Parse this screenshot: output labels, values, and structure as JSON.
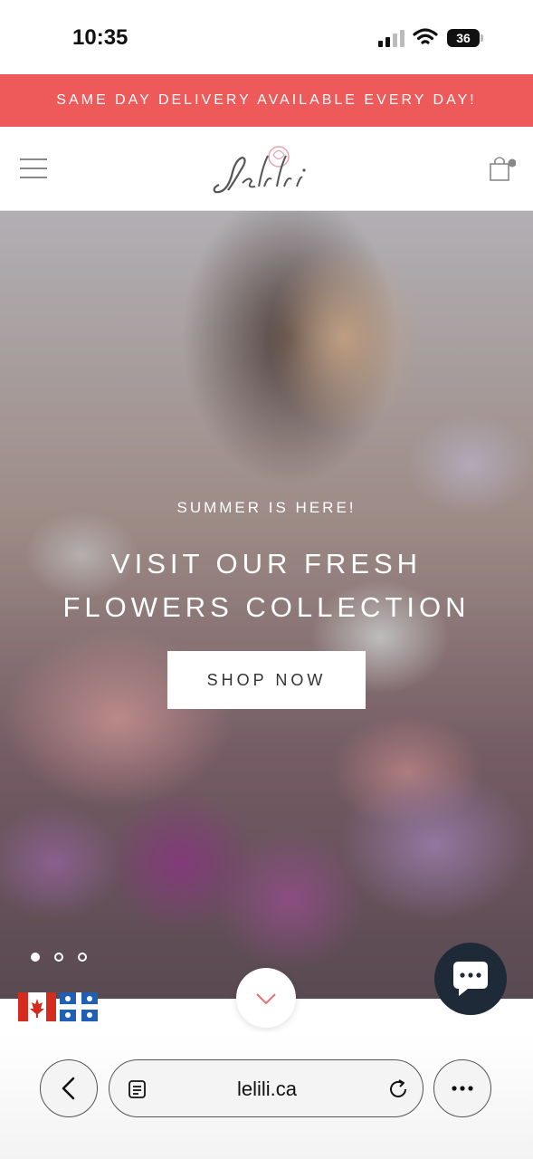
{
  "status_bar": {
    "time": "10:35",
    "battery": "36",
    "icons": [
      "signal-icon",
      "wifi-icon",
      "battery-icon"
    ]
  },
  "promo": {
    "text": "SAME DAY DELIVERY AVAILABLE EVERY DAY!",
    "color": "#ee5a59"
  },
  "header": {
    "logo_alt": "Lelili",
    "menu_icon": "hamburger-icon",
    "cart_icon": "shopping-bag-icon"
  },
  "hero": {
    "subtitle": "SUMMER IS HERE!",
    "title_line1": "VISIT OUR FRESH",
    "title_line2": "FLOWERS COLLECTION",
    "button": "SHOP NOW",
    "slides_total": 3,
    "slide_active": 1
  },
  "widgets": {
    "scroll_icon": "chevron-down-icon",
    "chat_icon": "chat-bubble-icon",
    "flags": [
      "canada-flag-icon",
      "quebec-flag-icon"
    ]
  },
  "browser": {
    "url": "lelili.ca",
    "icons": [
      "back-chevron-icon",
      "tabs-icon",
      "reload-icon",
      "more-icon"
    ]
  }
}
